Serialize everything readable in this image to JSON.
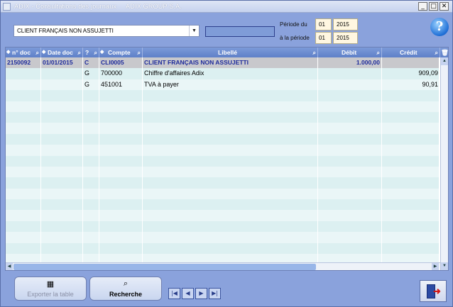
{
  "window": {
    "title": "ADIX - Consultations des journaux     ADIX GROUP S.A.",
    "controls": [
      "_",
      "□",
      "✕"
    ]
  },
  "filters": {
    "journal": "CLIENT FRANÇAIS NON ASSUJETTI",
    "search_value": "",
    "period_from_label": "Période du",
    "period_to_label": "à la période",
    "from_month": "01",
    "from_year": "2015",
    "to_month": "01",
    "to_year": "2015"
  },
  "grid": {
    "columns": [
      "n° doc",
      "Date doc",
      "?",
      "Compte",
      "Libellé",
      "Débit",
      "Crédit"
    ],
    "rows": [
      {
        "doc": "2150092",
        "date": "01/01/2015",
        "type": "C",
        "account": "CLI0005",
        "label": "CLIENT FRANÇAIS NON ASSUJETTI",
        "debit": "1.000,00",
        "credit": "",
        "selected": true
      },
      {
        "doc": "",
        "date": "",
        "type": "G",
        "account": "700000",
        "label": "Chiffre d'affaires Adix",
        "debit": "",
        "credit": "909,09",
        "selected": false
      },
      {
        "doc": "",
        "date": "",
        "type": "G",
        "account": "451001",
        "label": "TVA à payer",
        "debit": "",
        "credit": "90,91",
        "selected": false
      }
    ],
    "empty_rows": 16
  },
  "toolbar": {
    "export_label": "Exporter la table",
    "search_label": "Recherche",
    "nav": [
      "|◀",
      "◀",
      "▶",
      "▶|"
    ]
  },
  "icons": {
    "help": "help-icon",
    "exit": "exit-icon"
  },
  "colors": {
    "background": "#8aa2dc",
    "header": "#6888cf",
    "selected_text": "#1e2b9b"
  }
}
